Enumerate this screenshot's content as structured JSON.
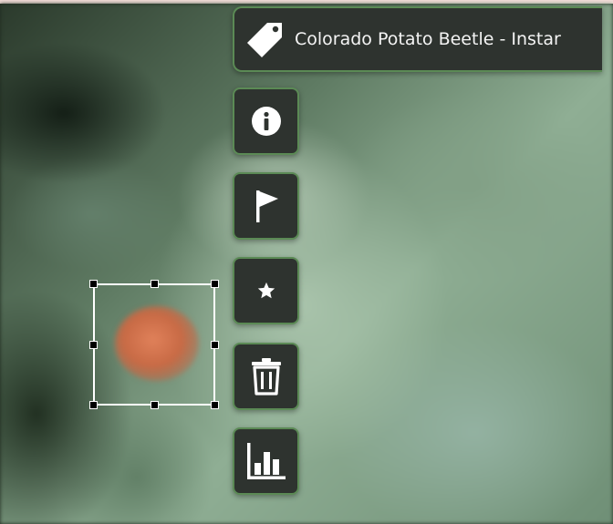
{
  "annotation": {
    "label": "Colorado Potato Beetle - Instar",
    "label_icon": "tag-icon"
  },
  "toolbar": [
    {
      "name": "info-button",
      "icon": "info-icon"
    },
    {
      "name": "flag-button",
      "icon": "flag-icon"
    },
    {
      "name": "favorite-button",
      "icon": "star-icon"
    },
    {
      "name": "delete-button",
      "icon": "trash-icon"
    },
    {
      "name": "stats-button",
      "icon": "bar-chart-icon"
    }
  ],
  "colors": {
    "panel_bg": "#2e332f",
    "panel_border": "#5b8a55",
    "icon": "#ffffff",
    "bbox": "#ffffff"
  }
}
